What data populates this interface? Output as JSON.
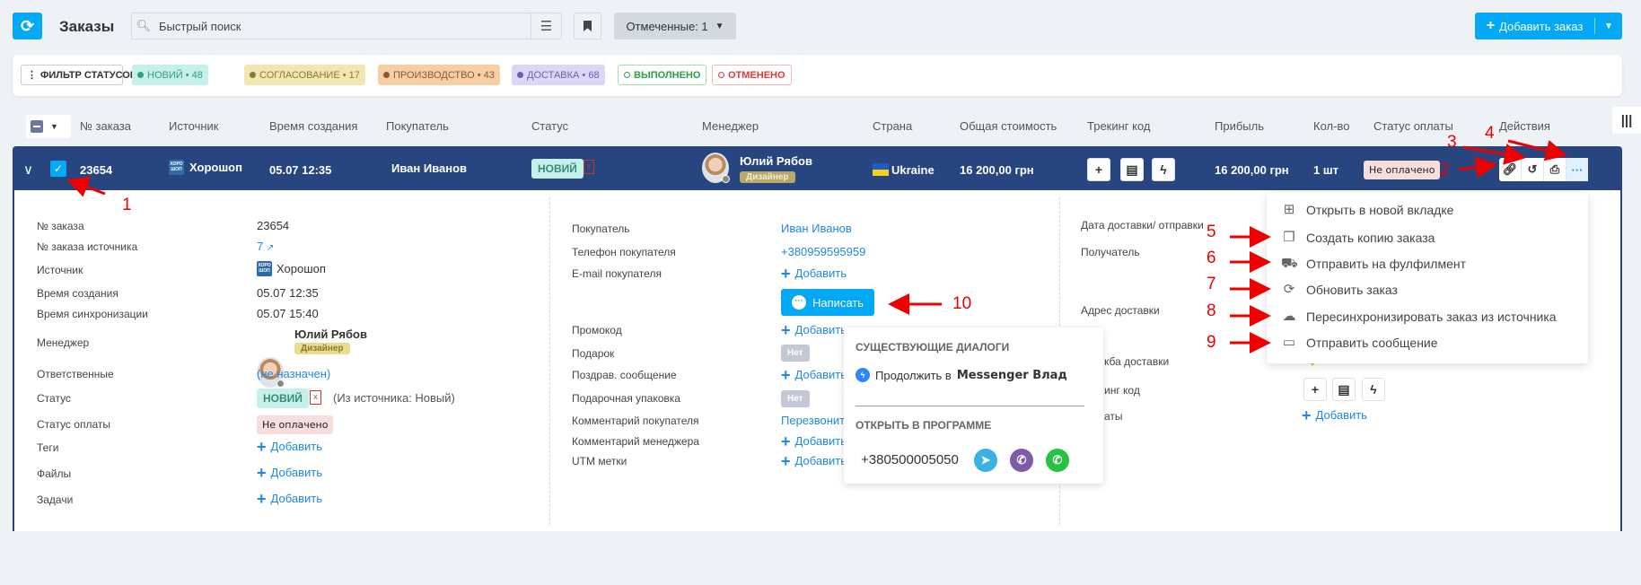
{
  "header": {
    "title": "Заказы",
    "search_placeholder": "Быстрый поиск",
    "marked_label": "Отмеченные: 1",
    "add_order_label": "Добавить заказ"
  },
  "filters": {
    "label": "ФИЛЬТР СТАТУСОВ",
    "chips": [
      {
        "label": "НОВИЙ • 48",
        "color": "#2f9e84",
        "bg": "#c5f1e8"
      },
      {
        "label": "СОГЛАСОВАНИЕ • 17",
        "color": "#8a7a35",
        "bg": "#f3e6b2"
      },
      {
        "label": "ПРОИЗВОДСТВО • 43",
        "color": "#8a5a35",
        "bg": "#f8cfa3"
      },
      {
        "label": "ДОСТАВКА • 68",
        "color": "#6a5fb0",
        "bg": "#ddd7f7"
      },
      {
        "label": "ВЫПОЛНЕНО",
        "color": "#2f9e44",
        "bg": "#ffffff"
      },
      {
        "label": "ОТМЕНЕНО",
        "color": "#e53935",
        "bg": "#ffffff"
      }
    ]
  },
  "columns": [
    "№ заказа",
    "Источник",
    "Время создания",
    "Покупатель",
    "Статус",
    "Менеджер",
    "Страна",
    "Общая стоимость",
    "Трекинг код",
    "Прибыль",
    "Кол-во",
    "Статус оплаты",
    "Действия"
  ],
  "order": {
    "number": "23654",
    "source": "Хорошоп",
    "created": "05.07 12:35",
    "buyer": "Иван Иванов",
    "status": "НОВИЙ",
    "manager": "Юлий Рябов",
    "manager_role": "Дизайнер",
    "country": "Ukraine",
    "total": "16 200,00 грн",
    "profit": "16 200,00 грн",
    "qty": "1 шт",
    "payment_status": "Не оплачено"
  },
  "details_left": {
    "labels": [
      "№ заказа",
      "№ заказа источника",
      "Источник",
      "Время создания",
      "Время синхронизации",
      "Менеджер",
      "Ответственные",
      "Статус",
      "Статус оплаты",
      "Теги",
      "Файлы",
      "Задачи"
    ],
    "order_no": "23654",
    "source_order_no": "7",
    "source": "Хорошоп",
    "created": "05.07 12:35",
    "synced": "05.07 15:40",
    "manager": "Юлий Рябов",
    "manager_role": "Дизайнер",
    "responsible": "(не назначен)",
    "status": "НОВИЙ",
    "status_source": "(Из источника: Новый)",
    "payment": "Не оплачено",
    "add": "Добавить"
  },
  "details_mid": {
    "labels": [
      "Покупатель",
      "Телефон покупателя",
      "E-mail покупателя",
      "Промокод",
      "Подарок",
      "Поздрав. сообщение",
      "Подарочная упаковка",
      "Комментарий покупателя",
      "Комментарий менеджера",
      "UTM метки"
    ],
    "buyer": "Иван Иванов",
    "phone": "+380959595959",
    "add": "Добавить",
    "write_button": "Написать",
    "no": "Нет",
    "buyer_comment": "Перезвонить"
  },
  "details_right": {
    "labels": [
      "Дата доставки/ отправки",
      "Получатель",
      "Адрес доставки",
      "кба доставки",
      "инг код",
      "аты"
    ],
    "add": "Добавить"
  },
  "dialogs_popup": {
    "existing_title": "СУЩЕСТВУЮЩИЕ ДИАЛОГИ",
    "continue_prefix": "Продолжить в",
    "continue_target": "Messenger Влад",
    "open_title": "ОТКРЫТЬ В ПРОГРАММЕ",
    "phone": "+380500005050"
  },
  "actions_menu": [
    {
      "label": "Открыть в новой вкладке",
      "icon": "new-tab-icon"
    },
    {
      "label": "Создать копию заказа",
      "icon": "copy-icon"
    },
    {
      "label": "Отправить на фулфилмент",
      "icon": "fulfillment-icon"
    },
    {
      "label": "Обновить заказ",
      "icon": "refresh-icon"
    },
    {
      "label": "Пересинхронизировать заказ из источника",
      "icon": "cloud-sync-icon"
    },
    {
      "label": "Отправить сообщение",
      "icon": "message-icon"
    }
  ],
  "annotations": [
    "1",
    "2",
    "3",
    "4",
    "5",
    "6",
    "7",
    "8",
    "9",
    "10"
  ],
  "colors": {
    "accent": "#03a9f4",
    "row": "#27467f",
    "link": "#1e88e5",
    "annotation": "#ee0000"
  }
}
